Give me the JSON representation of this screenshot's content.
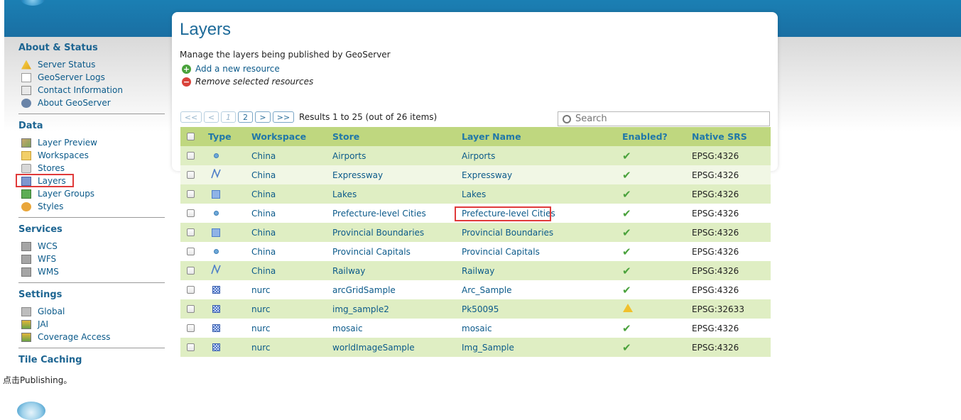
{
  "page": {
    "title": "Layers",
    "description": "Manage the layers being published by GeoServer",
    "add_label": "Add a new resource",
    "remove_label": "Remove selected resources"
  },
  "sidebar": {
    "sections": [
      {
        "title": "About & Status",
        "items": [
          {
            "label": "Server Status",
            "icon": "warning-icon"
          },
          {
            "label": "GeoServer Logs",
            "icon": "log-icon"
          },
          {
            "label": "Contact Information",
            "icon": "contact-card-icon"
          },
          {
            "label": "About GeoServer",
            "icon": "info-icon"
          }
        ]
      },
      {
        "title": "Data",
        "items": [
          {
            "label": "Layer Preview",
            "icon": "map-preview-icon"
          },
          {
            "label": "Workspaces",
            "icon": "folder-icon"
          },
          {
            "label": "Stores",
            "icon": "database-icon"
          },
          {
            "label": "Layers",
            "icon": "layer-icon"
          },
          {
            "label": "Layer Groups",
            "icon": "layer-group-icon"
          },
          {
            "label": "Styles",
            "icon": "palette-icon"
          }
        ]
      },
      {
        "title": "Services",
        "items": [
          {
            "label": "WCS",
            "icon": "service-icon"
          },
          {
            "label": "WFS",
            "icon": "service-icon"
          },
          {
            "label": "WMS",
            "icon": "service-icon"
          }
        ]
      },
      {
        "title": "Settings",
        "items": [
          {
            "label": "Global",
            "icon": "global-settings-icon"
          },
          {
            "label": "JAI",
            "icon": "jai-icon"
          },
          {
            "label": "Coverage Access",
            "icon": "coverage-icon"
          }
        ]
      },
      {
        "title": "Tile Caching",
        "items": []
      }
    ]
  },
  "pager": {
    "first": "<<",
    "prev": "<",
    "page1": "1",
    "page2": "2",
    "next": ">",
    "last": ">>",
    "results": "Results 1 to 25 (out of 26 items)"
  },
  "search": {
    "placeholder": "Search"
  },
  "table": {
    "columns": [
      "Type",
      "Workspace",
      "Store",
      "Layer Name",
      "Enabled?",
      "Native SRS"
    ],
    "rows": [
      {
        "type": "point",
        "workspace": "China",
        "store": "Airports",
        "layer": "Airports",
        "enabled": "yes",
        "srs": "EPSG:4326"
      },
      {
        "type": "line",
        "workspace": "China",
        "store": "Expressway",
        "layer": "Expressway",
        "enabled": "yes",
        "srs": "EPSG:4326"
      },
      {
        "type": "polygon",
        "workspace": "China",
        "store": "Lakes",
        "layer": "Lakes",
        "enabled": "yes",
        "srs": "EPSG:4326"
      },
      {
        "type": "point",
        "workspace": "China",
        "store": "Prefecture-level Cities",
        "layer": "Prefecture-level Cities",
        "enabled": "yes",
        "srs": "EPSG:4326"
      },
      {
        "type": "polygon",
        "workspace": "China",
        "store": "Provincial Boundaries",
        "layer": "Provincial Boundaries",
        "enabled": "yes",
        "srs": "EPSG:4326"
      },
      {
        "type": "point",
        "workspace": "China",
        "store": "Provincial Capitals",
        "layer": "Provincial Capitals",
        "enabled": "yes",
        "srs": "EPSG:4326"
      },
      {
        "type": "line",
        "workspace": "China",
        "store": "Railway",
        "layer": "Railway",
        "enabled": "yes",
        "srs": "EPSG:4326"
      },
      {
        "type": "raster",
        "workspace": "nurc",
        "store": "arcGridSample",
        "layer": "Arc_Sample",
        "enabled": "yes",
        "srs": "EPSG:4326"
      },
      {
        "type": "raster",
        "workspace": "nurc",
        "store": "img_sample2",
        "layer": "Pk50095",
        "enabled": "warning",
        "srs": "EPSG:32633"
      },
      {
        "type": "raster",
        "workspace": "nurc",
        "store": "mosaic",
        "layer": "mosaic",
        "enabled": "yes",
        "srs": "EPSG:4326"
      },
      {
        "type": "raster",
        "workspace": "nurc",
        "store": "worldImageSample",
        "layer": "Img_Sample",
        "enabled": "yes",
        "srs": "EPSG:4326"
      }
    ]
  },
  "caption": "点击Publishing。",
  "colors": {
    "accent": "#1d6a99",
    "header_row": "#bfd77f",
    "row_odd": "#dfeec3",
    "highlight": "#e03a3a"
  }
}
